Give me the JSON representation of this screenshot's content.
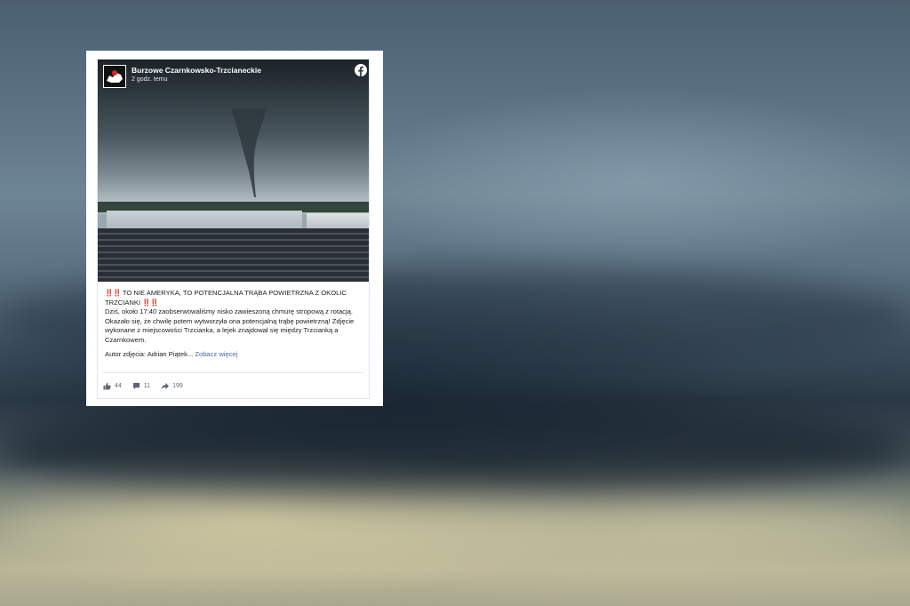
{
  "post": {
    "page_name": "Burzowe Czarnkowsko-Trzcianeckie",
    "time": "2 godz. temu",
    "headline_prefix": "‼️‼️",
    "headline": "TO NIE AMERYKA, TO POTENCJALNA TRĄBA POWIETRZNA Z OKOLIC TRZCIANKI",
    "headline_suffix": "‼️‼️",
    "body": "Dziś, około 17:40 zaobserwowaliśmy nisko zawieszoną chmurę stropową z rotacją. Okazało się, że chwilę potem wytworzyła ona potencjalną trąbę powietrzną! Zdjęcie wykonane z miejscowości Trzcianka, a lejek znajdował się między Trzcianką a Czarnkowem.",
    "author": "Autor zdjęcia: Adrian Piątek...",
    "see_more": "Zobacz więcej",
    "likes": "44",
    "comments": "11",
    "shares": "199",
    "icons": {
      "brand": "facebook-icon",
      "like": "thumbs-up-icon",
      "comment": "comment-icon",
      "share": "share-arrow-icon"
    }
  },
  "colors": {
    "link": "#4267b2",
    "text": "#1c1e21",
    "muted": "#606770",
    "emoji_red": "#e0245e"
  }
}
